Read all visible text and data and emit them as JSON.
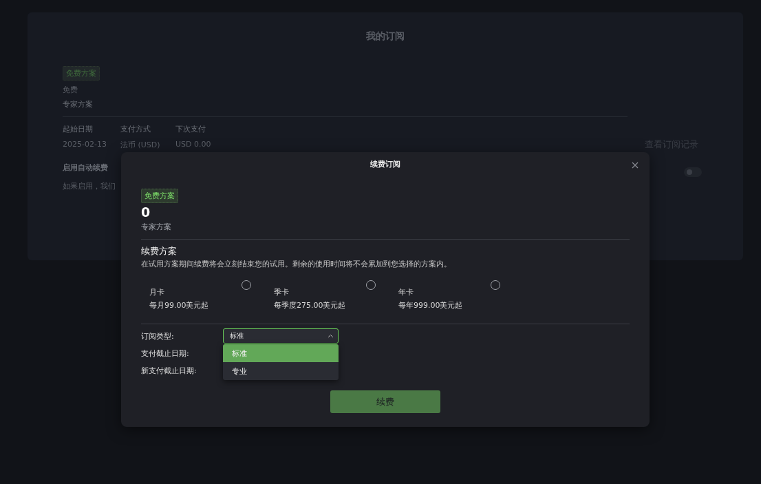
{
  "page": {
    "title": "我的订阅",
    "plan_badge": "免费方案",
    "price": "免费",
    "plan_name": "专家方案",
    "info_columns": [
      {
        "label": "起始日期",
        "value": "2025-02-13"
      },
      {
        "label": "支付方式",
        "value": "法币 (USD)"
      },
      {
        "label": "下次支付",
        "value": "USD 0.00"
      }
    ],
    "auto_renew": {
      "label": "启用自动续费",
      "description": "如果启用，我们",
      "on": false
    },
    "history_link": "查看订阅记录"
  },
  "dialog": {
    "title": "续费订阅",
    "plan_badge": "免费方案",
    "amount": "0",
    "plan_name": "专家方案",
    "section_title": "续费方案",
    "section_note": "在试用方案期间续费将会立刻结束您的试用。剩余的使用时间将不会累加到您选择的方案内。",
    "plans": [
      {
        "name": "月卡",
        "price": "每月99.00美元起",
        "selected": false
      },
      {
        "name": "季卡",
        "price": "每季度275.00美元起",
        "selected": false
      },
      {
        "name": "年卡",
        "price": "每年999.00美元起",
        "selected": false
      }
    ],
    "form": [
      {
        "label": "订阅类型:",
        "kind": "select"
      },
      {
        "label": "支付截止日期:",
        "kind": "text"
      },
      {
        "label": "新支付截止日期:",
        "kind": "text"
      }
    ],
    "select": {
      "value": "标准",
      "expanded": true,
      "options": [
        {
          "label": "标准",
          "selected": true
        },
        {
          "label": "专业",
          "selected": false
        }
      ]
    },
    "submit": "续费"
  }
}
